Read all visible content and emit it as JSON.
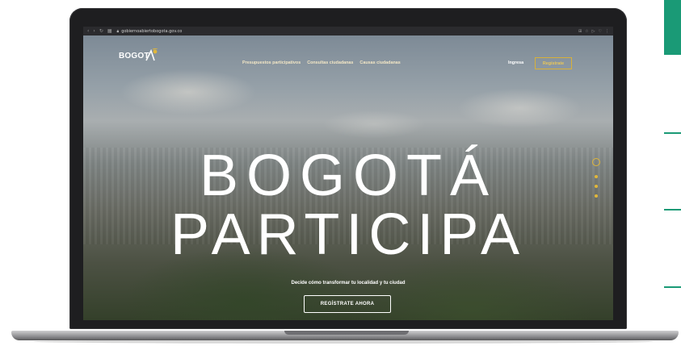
{
  "colors": {
    "accent_green": "#1a9a76",
    "accent_gold": "#e1b73a",
    "text_white": "#ffffff"
  },
  "browser": {
    "url": "gobiernoabiertobogota.gov.co",
    "nav_icons": [
      "back-icon",
      "forward-icon",
      "reload-icon",
      "tabs-icon"
    ],
    "lock_icon": "lock-icon",
    "action_icons": [
      "extensions-icon",
      "bookmark-icon",
      "share-icon",
      "heart-icon",
      "menu-icon"
    ]
  },
  "site": {
    "logo_text": "BOGOTÁ",
    "nav": [
      "Presupuestos participativos",
      "Consultas ciudadanas",
      "Causas ciudadanas"
    ],
    "login_label": "Ingresa",
    "register_label": "Regístrate"
  },
  "hero": {
    "title_line1": "BOGOTÁ",
    "title_line2": "PARTICIPA",
    "subtitle": "Decide cómo transformar tu localidad y tu ciudad",
    "cta_label": "REGÍSTRATE AHORA",
    "slides_total": 4,
    "active_slide": 1
  }
}
